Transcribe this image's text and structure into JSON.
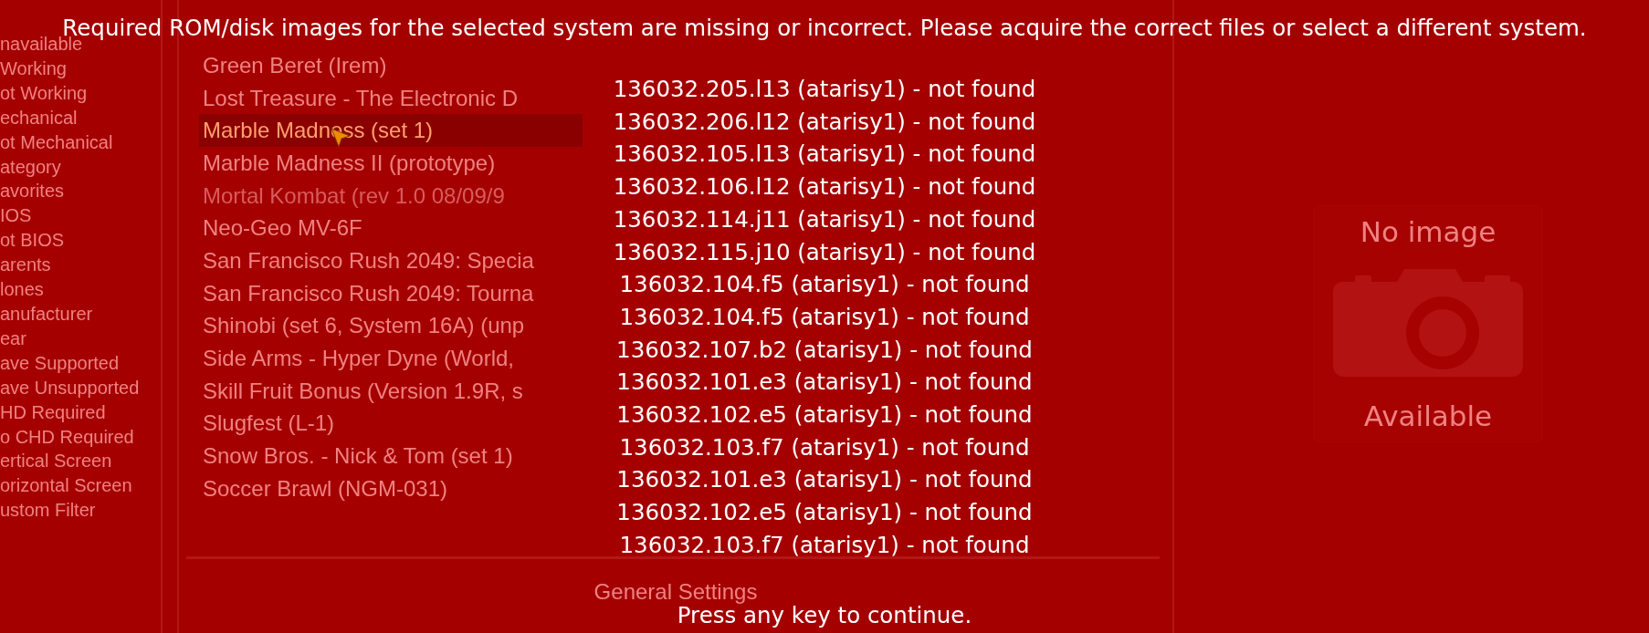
{
  "filters": {
    "items": [
      "navailable",
      "Working",
      "ot Working",
      "echanical",
      "ot Mechanical",
      "ategory",
      "avorites",
      "IOS",
      "ot BIOS",
      "arents",
      "lones",
      "anufacturer",
      "ear",
      "ave Supported",
      "ave Unsupported",
      "HD Required",
      "o CHD Required",
      "ertical Screen",
      "orizontal Screen",
      "ustom Filter"
    ]
  },
  "game_list": {
    "items": [
      {
        "title": "Green Beret (Irem)",
        "selected": false,
        "available": true
      },
      {
        "title": "Lost Treasure - The Electronic D",
        "selected": false,
        "available": true
      },
      {
        "title": "Marble Madness (set 1)",
        "selected": true,
        "available": true
      },
      {
        "title": "Marble Madness II (prototype)",
        "selected": false,
        "available": true
      },
      {
        "title": "Mortal Kombat (rev 1.0 08/09/9",
        "selected": false,
        "available": false
      },
      {
        "title": "Neo-Geo MV-6F",
        "selected": false,
        "available": true
      },
      {
        "title": "San Francisco Rush 2049: Specia",
        "selected": false,
        "available": true
      },
      {
        "title": "San Francisco Rush 2049: Tourna",
        "selected": false,
        "available": true
      },
      {
        "title": "Shinobi (set 6, System 16A) (unp",
        "selected": false,
        "available": true
      },
      {
        "title": "Side Arms - Hyper Dyne (World,",
        "selected": false,
        "available": true
      },
      {
        "title": "Skill Fruit Bonus (Version 1.9R, s",
        "selected": false,
        "available": true
      },
      {
        "title": "Slugfest (L-1)",
        "selected": false,
        "available": true
      },
      {
        "title": "Snow Bros. - Nick & Tom (set 1)",
        "selected": false,
        "available": true
      },
      {
        "title": "Soccer Brawl (NGM-031)",
        "selected": false,
        "available": true
      }
    ]
  },
  "settings_menu": {
    "items": [
      "General Settings"
    ]
  },
  "snapshot_panel": {
    "placeholder_top": "No image",
    "placeholder_bottom": "Available"
  },
  "error_dialog": {
    "message": "Required ROM/disk images for the selected system are missing or incorrect. Please acquire the correct files or select a different system.",
    "missing_files": [
      "136032.205.l13 (atarisy1) - not found",
      "136032.206.l12 (atarisy1) - not found",
      "136032.105.l13 (atarisy1) - not found",
      "136032.106.l12 (atarisy1) - not found",
      "136032.114.j11 (atarisy1) - not found",
      "136032.115.j10 (atarisy1) - not found",
      "136032.104.f5 (atarisy1) - not found",
      "136032.104.f5 (atarisy1) - not found",
      "136032.107.b2 (atarisy1) - not found",
      "136032.101.e3 (atarisy1) - not found",
      "136032.102.e5 (atarisy1) - not found",
      "136032.103.f7 (atarisy1) - not found",
      "136032.101.e3 (atarisy1) - not found",
      "136032.102.e5 (atarisy1) - not found",
      "136032.103.f7 (atarisy1) - not found"
    ],
    "prompt": "Press any key to continue."
  }
}
